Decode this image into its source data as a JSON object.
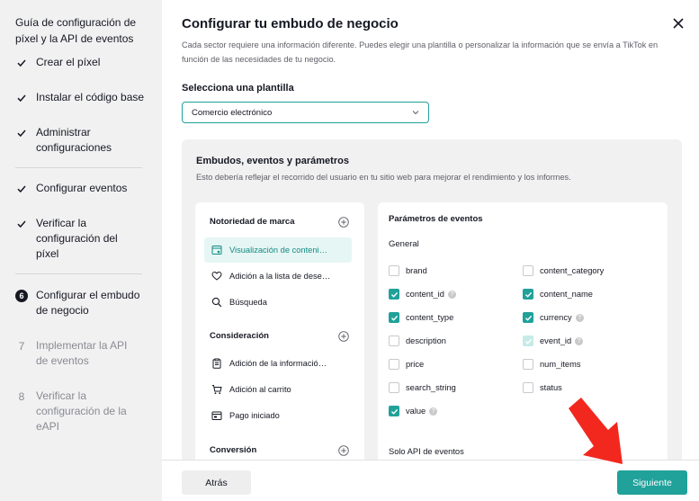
{
  "sidebar": {
    "title": "Guía de configuración de píxel y la API de eventos",
    "steps": [
      {
        "label": "Crear el píxel",
        "state": "done"
      },
      {
        "label": "Instalar el código base",
        "state": "done"
      },
      {
        "label": "Administrar configuraciones",
        "state": "done"
      },
      {
        "label": "Configurar eventos",
        "state": "done"
      },
      {
        "label": "Verificar la configuración del píxel",
        "state": "done"
      },
      {
        "label": "Configurar el embudo de negocio",
        "state": "active",
        "num": "6"
      },
      {
        "label": "Implementar la API de eventos",
        "state": "pending",
        "num": "7"
      },
      {
        "label": "Verificar la configuración de la eAPI",
        "state": "pending",
        "num": "8"
      }
    ]
  },
  "header": {
    "title": "Configurar tu embudo de negocio",
    "subtitle": "Cada sector requiere una información diferente. Puedes elegir una plantilla o personalizar la información que se envía a TikTok en función de las necesidades de tu negocio."
  },
  "template": {
    "label": "Selecciona una plantilla",
    "value": "Comercio electrónico"
  },
  "panel": {
    "title": "Embudos, eventos y parámetros",
    "description": "Esto debería reflejar el recorrido del usuario en tu sitio web para mejorar el rendimiento y los informes.",
    "groups": [
      {
        "label": "Notoriedad de marca",
        "events": [
          "Visualización de conteni…",
          "Adición a la lista de dese…",
          "Búsqueda"
        ]
      },
      {
        "label": "Consideración",
        "events": [
          "Adición de la informació…",
          "Adición al carrito",
          "Pago iniciado"
        ]
      },
      {
        "label": "Conversión",
        "events": []
      }
    ],
    "params_title": "Parámetros de eventos",
    "general_label": "General",
    "params": [
      {
        "name": "brand",
        "state": "unchecked",
        "info": false
      },
      {
        "name": "content_category",
        "state": "unchecked",
        "info": false
      },
      {
        "name": "content_id",
        "state": "checked",
        "info": true
      },
      {
        "name": "content_name",
        "state": "checked",
        "info": false
      },
      {
        "name": "content_type",
        "state": "checked",
        "info": false
      },
      {
        "name": "currency",
        "state": "checked",
        "info": true
      },
      {
        "name": "description",
        "state": "unchecked",
        "info": false
      },
      {
        "name": "event_id",
        "state": "disabled",
        "info": true
      },
      {
        "name": "price",
        "state": "unchecked",
        "info": false
      },
      {
        "name": "num_items",
        "state": "unchecked",
        "info": false
      },
      {
        "name": "search_string",
        "state": "unchecked",
        "info": false
      },
      {
        "name": "status",
        "state": "unchecked",
        "info": false
      },
      {
        "name": "value",
        "state": "checked",
        "info": true
      }
    ],
    "solo_label": "Solo API de eventos"
  },
  "footer": {
    "back_label": "Atrás",
    "next_label": "Siguiente"
  },
  "colors": {
    "accent": "#20a19a",
    "arrow": "#f2281e"
  }
}
